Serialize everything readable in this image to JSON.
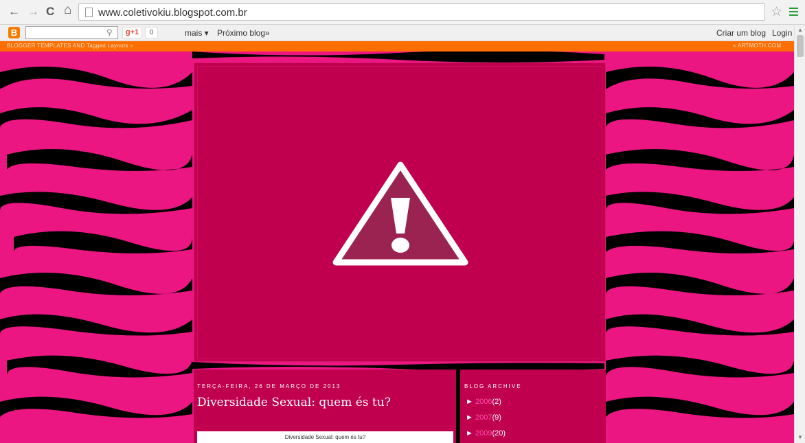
{
  "browser": {
    "url": "www.coletivokiu.blogspot.com.br",
    "back_icon": "←",
    "forward_icon": "→",
    "reload_icon": "C",
    "home_icon": "⌂",
    "star_icon": "☆"
  },
  "blogger_bar": {
    "logo": "B",
    "gplus": "g+1",
    "gplus_count": "0",
    "more": "mais ▾",
    "next_blog": "Próximo blog»",
    "create": "Criar um blog",
    "login": "Login"
  },
  "orange_bar": {
    "left": "BLOGGER TEMPLATES AND Tagged Layouts »",
    "right": "« ARTMOTH.COM"
  },
  "post": {
    "date": "TERÇA-FEIRA, 26 DE MARÇO DE 2013",
    "title": "Diversidade Sexual: quem és tu?",
    "image_caption": "Diversidade Sexual: quem és tu?"
  },
  "sidebar": {
    "title": "BLOG ARCHIVE",
    "items": [
      {
        "year": "2006",
        "count": "(2)"
      },
      {
        "year": "2007",
        "count": "(9)"
      },
      {
        "year": "2009",
        "count": "(20)"
      }
    ]
  },
  "colors": {
    "accent": "#c0004f",
    "zebra_pink": "#ec1682",
    "orange": "#ff6e00"
  }
}
